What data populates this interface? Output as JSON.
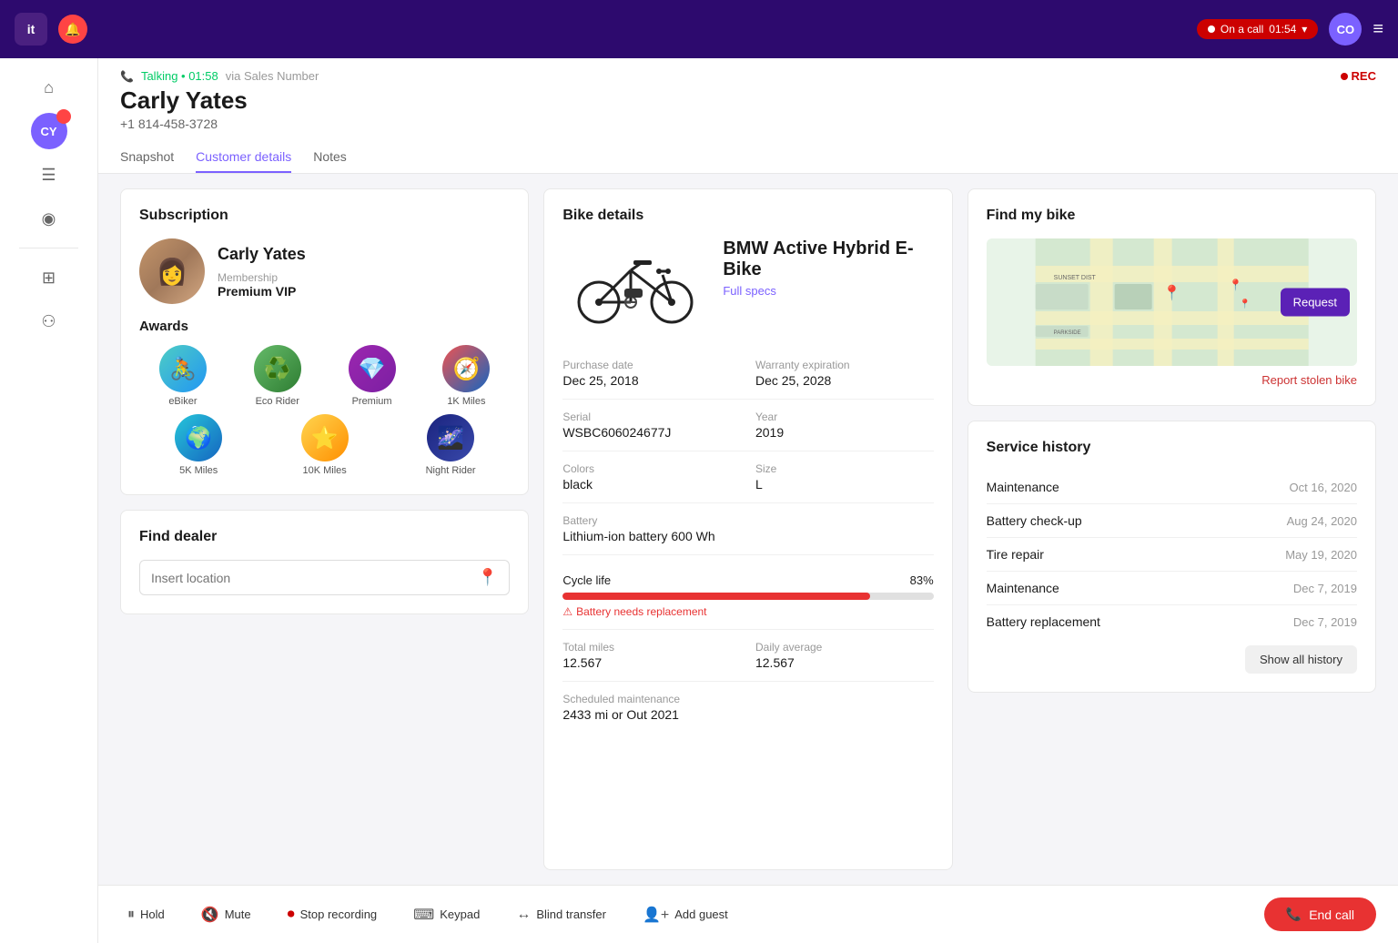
{
  "topbar": {
    "logo": "it",
    "on_call_label": "On a call",
    "timer": "01:54",
    "avatar": "CO",
    "chevron": "▾"
  },
  "sidebar": {
    "icons": [
      "⌂",
      "≡",
      "☰",
      "◉",
      "⊞",
      "⚇"
    ]
  },
  "call_header": {
    "status": "Talking • 01:58",
    "via": "via Sales Number",
    "customer_name": "Carly Yates",
    "phone": "+1 814-458-3728",
    "rec": "REC",
    "tabs": [
      "Snapshot",
      "Customer details",
      "Notes"
    ],
    "active_tab": "Customer details"
  },
  "subscription": {
    "title": "Subscription",
    "customer_name": "Carly Yates",
    "membership_label": "Membership",
    "membership_value": "Premium VIP"
  },
  "awards": {
    "title": "Awards",
    "items": [
      {
        "label": "eBiker",
        "emoji": "🚴"
      },
      {
        "label": "Eco Rider",
        "emoji": "♻️"
      },
      {
        "label": "Premium",
        "emoji": "💎"
      },
      {
        "label": "1K Miles",
        "emoji": "🧭"
      },
      {
        "label": "5K Miles",
        "emoji": "🌍"
      },
      {
        "label": "10K Miles",
        "emoji": "⭐"
      },
      {
        "label": "Night Rider",
        "emoji": "🌌"
      }
    ]
  },
  "find_dealer": {
    "title": "Find dealer",
    "placeholder": "Insert location"
  },
  "bike_details": {
    "title": "Bike details",
    "name": "BMW Active Hybrid E-Bike",
    "full_specs": "Full specs",
    "purchase_date_label": "Purchase date",
    "purchase_date": "Dec 25, 2018",
    "warranty_label": "Warranty expiration",
    "warranty": "Dec 25, 2028",
    "serial_label": "Serial",
    "serial": "WSBC606024677J",
    "year_label": "Year",
    "year": "2019",
    "colors_label": "Colors",
    "colors": "black",
    "size_label": "Size",
    "size": "L",
    "battery_label": "Battery",
    "battery": "Lithium-ion battery 600 Wh",
    "cycle_life_label": "Cycle life",
    "cycle_life_pct": "83%",
    "cycle_life_fill": 83,
    "battery_warning": "Battery needs replacement",
    "total_miles_label": "Total miles",
    "total_miles": "12.567",
    "daily_avg_label": "Daily average",
    "daily_avg": "12.567",
    "scheduled_label": "Scheduled maintenance",
    "scheduled": "2433 mi or Out 2021"
  },
  "find_my_bike": {
    "title": "Find my bike",
    "request_btn": "Request",
    "report_link": "Report stolen bike"
  },
  "service_history": {
    "title": "Service history",
    "items": [
      {
        "name": "Maintenance",
        "date": "Oct 16, 2020"
      },
      {
        "name": "Battery check-up",
        "date": "Aug 24, 2020"
      },
      {
        "name": "Tire repair",
        "date": "May 19, 2020"
      },
      {
        "name": "Maintenance",
        "date": "Dec 7, 2019"
      },
      {
        "name": "Battery replacement",
        "date": "Dec 7, 2019"
      }
    ],
    "show_all": "Show all history"
  },
  "call_bar": {
    "hold": "Hold",
    "mute": "Mute",
    "stop_recording": "Stop recording",
    "keypad": "Keypad",
    "blind_transfer": "Blind transfer",
    "add_guest": "Add guest",
    "end_call": "End call"
  }
}
